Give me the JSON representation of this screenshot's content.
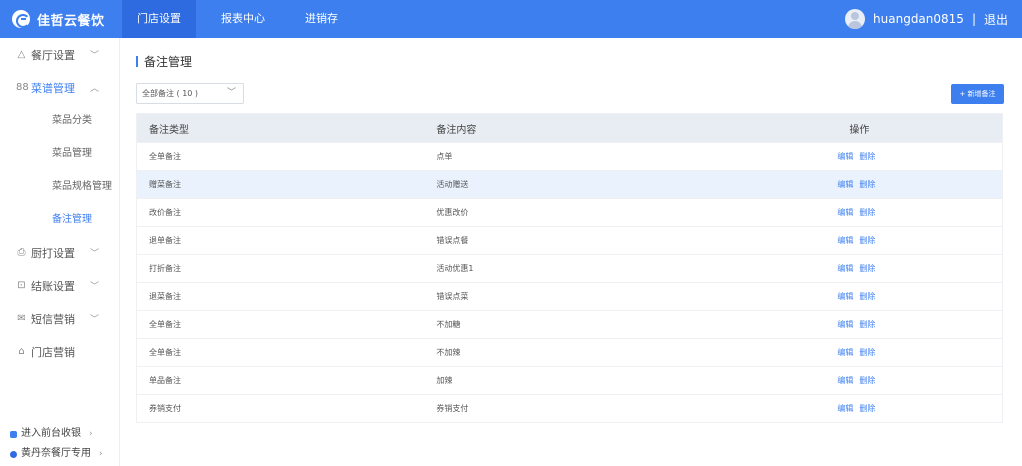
{
  "header": {
    "brand": "佳哲云餐饮",
    "nav": [
      "门店设置",
      "报表中心",
      "进销存"
    ],
    "active_nav": 0,
    "username": "huangdan0815",
    "separator": "|",
    "logout": "退出"
  },
  "sidebar": {
    "items": [
      {
        "label": "餐厅设置",
        "icon": "△",
        "chevron": "﹀"
      },
      {
        "label": "菜谱管理",
        "icon": "88",
        "chevron": "︿"
      },
      {
        "label": "厨打设置",
        "icon": "⎙",
        "chevron": "﹀"
      },
      {
        "label": "结账设置",
        "icon": "⊡",
        "chevron": "﹀"
      },
      {
        "label": "短信营销",
        "icon": "✉",
        "chevron": "﹀"
      },
      {
        "label": "门店营销",
        "icon": "⌂"
      }
    ],
    "submenu": [
      "菜品分类",
      "菜品管理",
      "菜品规格管理",
      "备注管理"
    ],
    "active_sub": 3,
    "bottom": [
      {
        "label": "进入前台收银",
        "arrow": "›"
      },
      {
        "label": "黄丹奈餐厅专用",
        "arrow": "›"
      }
    ]
  },
  "page": {
    "title": "备注管理",
    "filter_value": "全部备注 ( 10 )",
    "add_button": "+ 新增备注"
  },
  "table": {
    "headers": [
      "备注类型",
      "备注内容",
      "操作"
    ],
    "actions": {
      "edit": "编辑",
      "delete": "删除"
    },
    "highlight_row": 1,
    "rows": [
      {
        "type": "全单备注",
        "content": "点单"
      },
      {
        "type": "赠菜备注",
        "content": "活动赠送"
      },
      {
        "type": "改价备注",
        "content": "优惠改价"
      },
      {
        "type": "退单备注",
        "content": "错误点餐"
      },
      {
        "type": "打折备注",
        "content": "活动优惠1"
      },
      {
        "type": "退菜备注",
        "content": "错误点菜"
      },
      {
        "type": "全单备注",
        "content": "不加糖"
      },
      {
        "type": "全单备注",
        "content": "不加辣"
      },
      {
        "type": "单品备注",
        "content": "加辣"
      },
      {
        "type": "券销支付",
        "content": "券销支付"
      }
    ]
  },
  "colors": {
    "primary": "#3e7ff0",
    "header_bg": "#3e7ff0",
    "table_header_bg": "#e8ecf3",
    "row_highlight": "#eaf3fd"
  }
}
